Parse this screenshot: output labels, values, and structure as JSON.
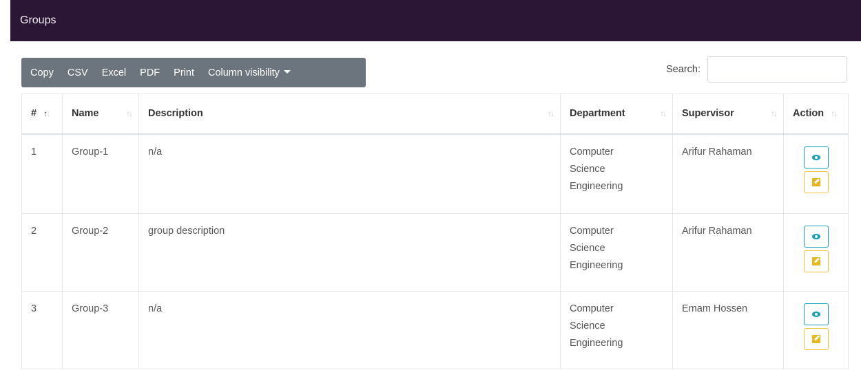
{
  "header": {
    "title": "Groups"
  },
  "toolbar": {
    "copy": "Copy",
    "csv": "CSV",
    "excel": "Excel",
    "pdf": "PDF",
    "print": "Print",
    "column_visibility": "Column visibility"
  },
  "search": {
    "label": "Search:",
    "value": "",
    "placeholder": ""
  },
  "table": {
    "headers": {
      "num": "#",
      "name": "Name",
      "description": "Description",
      "department": "Department",
      "supervisor": "Supervisor",
      "action": "Action"
    },
    "rows": [
      {
        "num": "1",
        "name": "Group-1",
        "description": "n/a",
        "dept1": "Computer",
        "dept2": "Science",
        "dept3": "Engineering",
        "supervisor": "Arifur Rahaman"
      },
      {
        "num": "2",
        "name": "Group-2",
        "description": "group description",
        "dept1": "Computer",
        "dept2": "Science",
        "dept3": "Engineering",
        "supervisor": "Arifur Rahaman"
      },
      {
        "num": "3",
        "name": "Group-3",
        "description": "n/a",
        "dept1": "Computer",
        "dept2": "Science",
        "dept3": "Engineering",
        "supervisor": "Emam Hossen"
      }
    ]
  },
  "sort_icons": {
    "up": "↑",
    "down": "↓"
  },
  "icons": {
    "view": "eye-icon",
    "edit": "edit-icon"
  },
  "colors": {
    "header_bg": "#2b1635",
    "toolbar_bg": "#6c757d",
    "view_accent": "#17a2b8",
    "edit_accent": "#f0c330"
  }
}
